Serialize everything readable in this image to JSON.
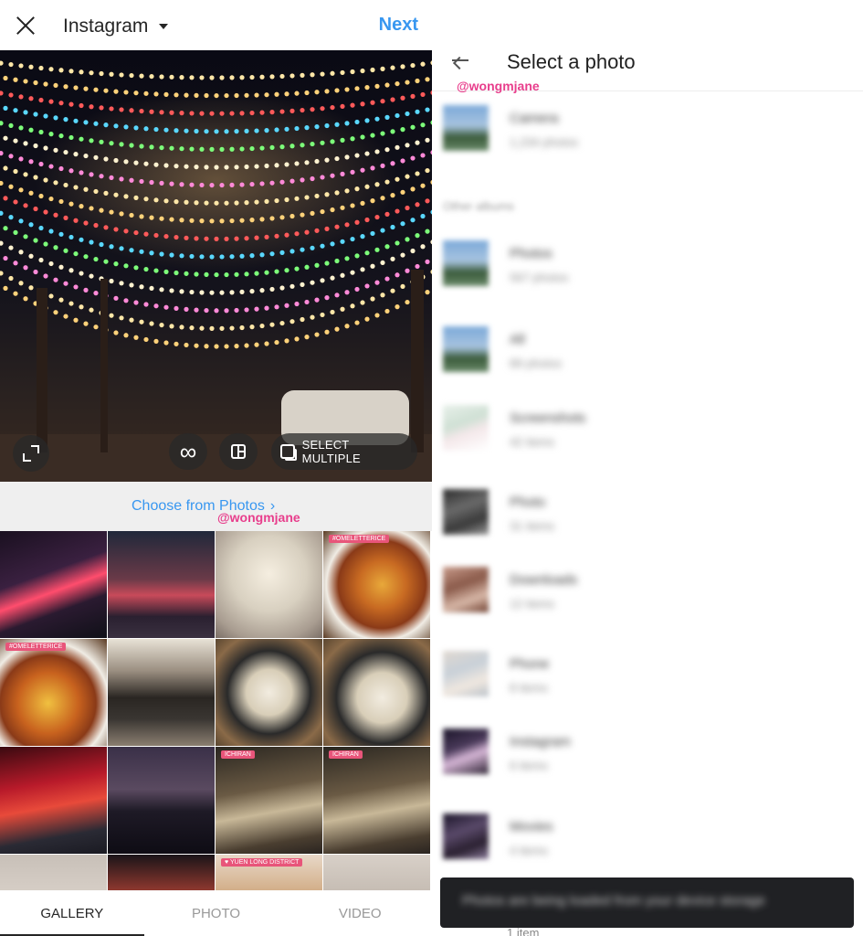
{
  "left": {
    "header": {
      "album_title": "Instagram",
      "next_label": "Next"
    },
    "preview": {
      "select_multiple_label": "SELECT MULTIPLE",
      "boomerang_glyph": "∞"
    },
    "choose_link": "Choose from Photos",
    "choose_chevron": "›",
    "watermark": "@wongmjane",
    "grid": [
      {
        "kind": "street-night",
        "bg": "linear-gradient(160deg,#1a1020 0%,#3a2040 40%,#ff4d6d 55%,#2a1a30 70%,#101018 100%)"
      },
      {
        "kind": "neon-street",
        "bg": "linear-gradient(180deg,#20283a 0%,#6a3a48 45%,#c84a5a 60%,#2a2030 80%,#3a3040 100%)"
      },
      {
        "kind": "lights-canopy",
        "bg": "radial-gradient(circle at 50% 40%,#f5eee0 0%,#d8d0c0 45%,#a89c90 80%,#7a6e66 100%)"
      },
      {
        "kind": "curry-plate",
        "bg": "radial-gradient(circle at 55% 50%,#e8a83a 0%,#c86a22 30%,#8a3a18 55%,#f0ece4 70%,#5a3a22 100%)",
        "tag": "#OMELETTERICE"
      },
      {
        "kind": "curry-plate",
        "bg": "radial-gradient(circle at 45% 60%,#f0c040 0%,#c8621e 35%,#8a3a18 55%,#f0ece4 70%,#5a3a22 100%)",
        "tag": "#OMELETTERICE"
      },
      {
        "kind": "wework-sign",
        "bg": "linear-gradient(180deg,#e8e2d6 0%,#9a8e80 30%,#2a2622 55%,#3a3632 75%,#8a7e70 100%)"
      },
      {
        "kind": "ramen-bowl",
        "bg": "radial-gradient(circle at 50% 50%,#f2ece0 0%,#d8ceb8 30%,#2a2a2a 55%,#8a6a48 80%,#5a4630 100%)"
      },
      {
        "kind": "ramen-bowl",
        "bg": "radial-gradient(circle at 55% 55%,#f2ece0 0%,#d8ceb8 30%,#2a2a2a 55%,#8a6a48 80%,#5a4630 100%)"
      },
      {
        "kind": "red-lanterns",
        "bg": "linear-gradient(170deg,#3a0a10 0%,#b81a2a 35%,#e84a3a 55%,#2a2a34 80%,#1a1a22 100%)"
      },
      {
        "kind": "skyline-night",
        "bg": "linear-gradient(180deg,#3a3048 0%,#5a4a60 40%,#1e1a26 60%,#0e0c14 100%)"
      },
      {
        "kind": "tea-tray",
        "bg": "linear-gradient(170deg,#2a2620 0%,#6a5a44 40%,#c8b898 60%,#4a3e30 85%,#2a2420 100%)",
        "tag": "ICHIRAN"
      },
      {
        "kind": "tea-tray",
        "bg": "linear-gradient(170deg,#2a2620 0%,#6a5a44 40%,#c8b898 60%,#4a3e30 85%,#2a2420 100%)",
        "tag": "ICHIRAN"
      },
      {
        "kind": "building",
        "bg": "linear-gradient(180deg,#c8c0b8 0%,#e0d8d0 60%,#a09890 100%)"
      },
      {
        "kind": "street-sign",
        "bg": "linear-gradient(180deg,#1a1418 0%,#c84a3a 50%,#2a2024 100%)"
      },
      {
        "kind": "district-sign",
        "bg": "linear-gradient(180deg,#e8d8c8 0%,#c89a6a 50%,#4a3a2a 100%)",
        "tag": "♥ YUEN LONG DISTRICT"
      },
      {
        "kind": "building",
        "bg": "linear-gradient(180deg,#d8d0c8 0%,#b8aea4 60%,#8a8078 100%)"
      }
    ],
    "tabs": [
      {
        "label": "GALLERY",
        "active": true
      },
      {
        "label": "PHOTO",
        "active": false
      },
      {
        "label": "VIDEO",
        "active": false
      }
    ]
  },
  "right": {
    "title": "Select a photo",
    "watermark": "@wongmjane",
    "section_label": "Other albums",
    "albums": [
      {
        "name": "Camera",
        "count": "1,234 photos",
        "thumb": "linear-gradient(180deg,#7aa8d8 0%,#a8c4e0 45%,#3a5a3a 70%,#6a8a6a 100%)"
      },
      {
        "name": "Photos",
        "count": "567 photos",
        "thumb": "linear-gradient(180deg,#7aa8d8 0%,#a8c4e0 45%,#3a5a3a 70%,#6a8a6a 100%)"
      },
      {
        "name": "All",
        "count": "89 photos",
        "thumb": "linear-gradient(180deg,#7aa8d8 0%,#a8c4e0 45%,#3a5a3a 70%,#6a8a6a 100%)"
      },
      {
        "name": "Screenshots",
        "count": "42 items",
        "thumb": "linear-gradient(160deg,#e8f0ea 0%,#cfe0d4 40%,#f4e8ea 60%,#ffffff 100%)"
      },
      {
        "name": "Photo",
        "count": "31 items",
        "thumb": "linear-gradient(160deg,#2a2a2a 0%,#6a6a6a 40%,#3a3a3a 70%,#9a9a9a 100%)"
      },
      {
        "name": "Downloads",
        "count": "12 items",
        "thumb": "linear-gradient(160deg,#c89a8a 0%,#8a5a4a 40%,#d8b8a8 70%,#6a3a2a 100%)"
      },
      {
        "name": "Phone",
        "count": "8 items",
        "thumb": "linear-gradient(160deg,#e0d8d0 0%,#c8d0d8 40%,#f0e8e0 70%,#b8c0c8 100%)"
      },
      {
        "name": "Instagram",
        "count": "6 items",
        "thumb": "linear-gradient(160deg,#1a1428 0%,#4a3a5a 40%,#d8b8d8 60%,#2a2030 100%)"
      },
      {
        "name": "Movies",
        "count": "4 items",
        "thumb": "linear-gradient(160deg,#1a1428 0%,#5a4a6a 40%,#2a2030 70%,#8a7a9a 100%)"
      }
    ],
    "snackbar_text": "Photos are being loaded from your device storage",
    "peek_count": "1 item"
  }
}
